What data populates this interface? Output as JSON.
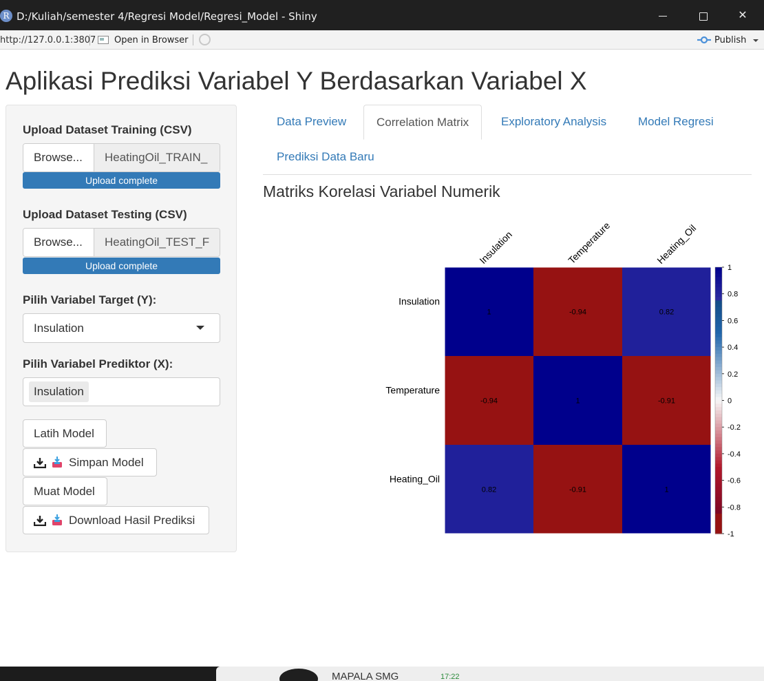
{
  "window": {
    "title": "D:/Kuliah/semester 4/Regresi Model/Regresi_Model - Shiny",
    "app_icon_letter": "R",
    "minimize_symbol": "",
    "close_symbol": "✕"
  },
  "addressbar": {
    "url": "http://127.0.0.1:3807",
    "open_in_browser": "Open in Browser",
    "publish": "Publish"
  },
  "page": {
    "title": "Aplikasi Prediksi Variabel Y Berdasarkan Variabel X"
  },
  "sidebar": {
    "training": {
      "label": "Upload Dataset Training (CSV)",
      "browse": "Browse...",
      "filename": "HeatingOil_TRAIN_",
      "progress": "Upload complete",
      "progress_value": 1.0
    },
    "testing": {
      "label": "Upload Dataset Testing (CSV)",
      "browse": "Browse...",
      "filename": "HeatingOil_TEST_F",
      "progress": "Upload complete",
      "progress_value": 1.0
    },
    "target": {
      "label": "Pilih Variabel Target (Y):",
      "selected": "Insulation"
    },
    "predictor": {
      "label": "Pilih Variabel Prediktor (X):",
      "selected": [
        "Insulation"
      ]
    },
    "buttons": {
      "train": "Latih Model",
      "save": "Simpan Model",
      "load": "Muat Model",
      "download": "Download Hasil Prediksi"
    }
  },
  "tabs": [
    {
      "label": "Data Preview",
      "active": false
    },
    {
      "label": "Correlation Matrix",
      "active": true
    },
    {
      "label": "Exploratory Analysis",
      "active": false
    },
    {
      "label": "Model Regresi",
      "active": false
    },
    {
      "label": "Prediksi Data Baru",
      "active": false
    }
  ],
  "section": {
    "title": "Matriks Korelasi Variabel Numerik"
  },
  "chart_data": {
    "type": "heatmap",
    "variables": [
      "Insulation",
      "Temperature",
      "Heating_Oil"
    ],
    "matrix": [
      [
        1,
        -0.94,
        0.82
      ],
      [
        -0.94,
        1,
        -0.91
      ],
      [
        0.82,
        -0.91,
        1
      ]
    ],
    "cell_labels": [
      [
        "1",
        "-0.94",
        "0.82"
      ],
      [
        "-0.94",
        "1",
        "-0.91"
      ],
      [
        "0.82",
        "-0.91",
        "1"
      ]
    ],
    "colorbar": {
      "range": [
        -1,
        1
      ],
      "ticks": [
        "1",
        "0.8",
        "0.6",
        "0.4",
        "0.2",
        "0",
        "-0.2",
        "-0.4",
        "-0.6",
        "-0.8",
        "-1"
      ],
      "tick_values": [
        1,
        0.8,
        0.6,
        0.4,
        0.2,
        0,
        -0.2,
        -0.4,
        -0.6,
        -0.8,
        -1
      ],
      "colors": {
        "negative": "#67001F",
        "neutral": "#F7F7F7",
        "positive": "#053061"
      },
      "colormap": "blue-white-red"
    },
    "column_labels_rotated": true,
    "legend": "right"
  },
  "taskbar": {
    "label": "MAPALA SMG",
    "time": "17:22"
  },
  "colors": {
    "accent": "#337ab7",
    "sidebar_bg": "#f5f5f5",
    "titlebar": "#202020"
  }
}
